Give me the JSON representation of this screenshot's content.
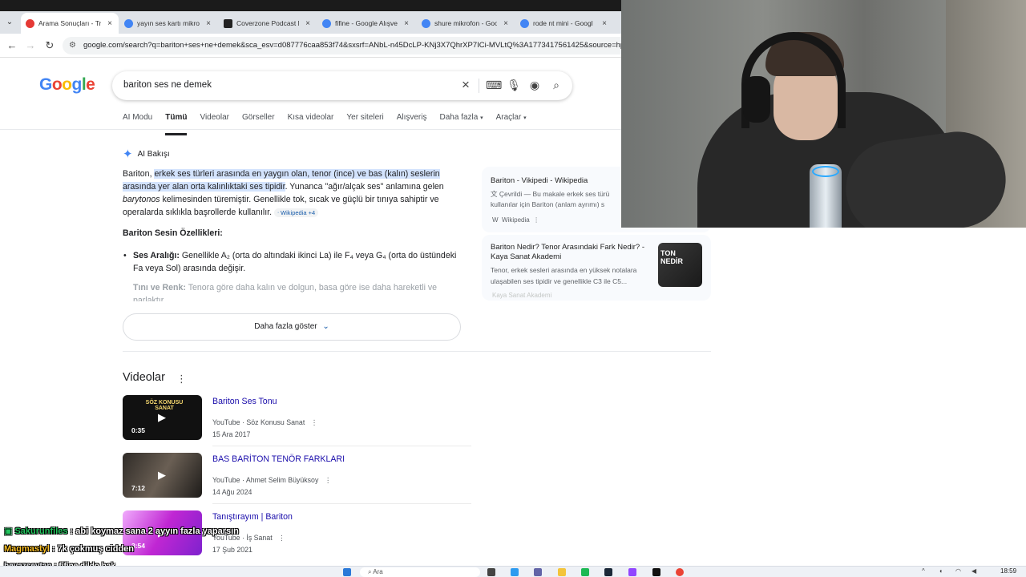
{
  "browser": {
    "tabs": [
      {
        "label": "Arama Sonuçları - Tre",
        "color": "#e53935"
      },
      {
        "label": "yayın ses kartı mikrof",
        "color": "#4285f4"
      },
      {
        "label": "Coverzone Podcast M",
        "color": "#222222"
      },
      {
        "label": "fifine - Google Alışve",
        "color": "#4285f4"
      },
      {
        "label": "shure mikrofon - Goo",
        "color": "#4285f4"
      },
      {
        "label": "rode nt mini - Googl",
        "color": "#4285f4"
      }
    ],
    "url": "google.com/search?q=bariton+ses+ne+demek&sca_esv=d087776caa853f74&sxsrf=ANbL-n45DcLP-KNj3X7QhrXP7ICi-MVLtQ%3A1773417561425&source=hp&ei"
  },
  "search": {
    "logo": [
      "G",
      "o",
      "o",
      "g",
      "l",
      "e"
    ],
    "query": "bariton ses ne demek",
    "tabs": [
      "AI Modu",
      "Tümü",
      "Videolar",
      "Görseller",
      "Kısa videolar",
      "Yer siteleri",
      "Alışveriş",
      "Daha fazla",
      "Araçlar"
    ],
    "active_tab": "Tümü"
  },
  "ai_overview": {
    "heading": "AI Bakışı",
    "intro_prefix": "Bariton, ",
    "intro_highlight": "erkek ses türleri arasında en yaygın olan, tenor (ince) ve bas (kalın) seslerin arasında yer alan orta kalınlıktaki ses tipidir",
    "intro_mid": ". Yunanca \"ağır/alçak ses\" anlamına gelen ",
    "intro_italic": "barytonos",
    "intro_suffix": " kelimesinden türemiştir. Genellikle tok, sıcak ve güçlü bir tınıya sahiptir ve operalarda sıklıkla başrollerde kullanılır.",
    "chip": "Wikipedia +4",
    "subheading": "Bariton Sesin Özellikleri:",
    "bullet1_label": "Ses Aralığı:",
    "bullet1_text": " Genellikle A₂ (orta do altındaki ikinci La) ile F₄ veya G₄ (orta do üstündeki Fa veya Sol) arasında değişir.",
    "bullet2_label": "Tını ve Renk:",
    "bullet2_text": " Tenora göre daha kalın ve dolgun, basa göre ise daha hareketli ve parlaktır.",
    "more_button": "Daha fazla göster"
  },
  "sources": [
    {
      "title": "Bariton - Vikipedi - Wikipedia",
      "snippet1": "Çevrildi — Bu makale erkek ses türü",
      "snippet2": "kullanılar için Bariton (anlam ayrımı) s",
      "source": "Wikipedia"
    },
    {
      "title1": "Bariton Nedir? Tenor Arasındaki Fark Nedir? -",
      "title2": "Kaya Sanat Akademi",
      "snippet1": "Tenor, erkek sesleri arasında en yüksek notalara",
      "snippet2": "ulaşabilen ses tipidir ve genellikle C3 ile C5...",
      "source": "Kaya Sanat Akademi",
      "thumb_text": "TON NEDİR"
    }
  ],
  "videos": {
    "heading": "Videolar",
    "items": [
      {
        "title": "Bariton Ses Tonu",
        "source": "YouTube · Söz Konusu Sanat",
        "date": "15 Ara 2017",
        "duration": "0:35",
        "thumb_label": "SÖZ KONUSU SANAT",
        "thumb_color": "#111111"
      },
      {
        "title": "BAS BARİTON TENÖR FARKLARI",
        "source": "YouTube · Ahmet Selim Büyüksoy",
        "date": "14 Ağu 2024",
        "duration": "7:12",
        "thumb_label": "",
        "thumb_color": "#3a3530"
      },
      {
        "title": "Tanıştırayım | Bariton",
        "source": "YouTube · İş Sanat",
        "date": "17 Şub 2021",
        "duration": "3:54",
        "thumb_label": "",
        "thumb_color": "#c026d3"
      }
    ]
  },
  "chat": [
    {
      "user": "Sakurunfiles",
      "message": " : abi koymaz sana 2 ayyın fazla yaparsın"
    },
    {
      "user": "Magmastyl",
      "message": " : 7k çokmuş cidden"
    },
    {
      "user": "beyazseytan",
      "message": " : fifine dildo bak"
    }
  ],
  "taskbar": {
    "search_placeholder": "Ara",
    "time": "18:59"
  }
}
